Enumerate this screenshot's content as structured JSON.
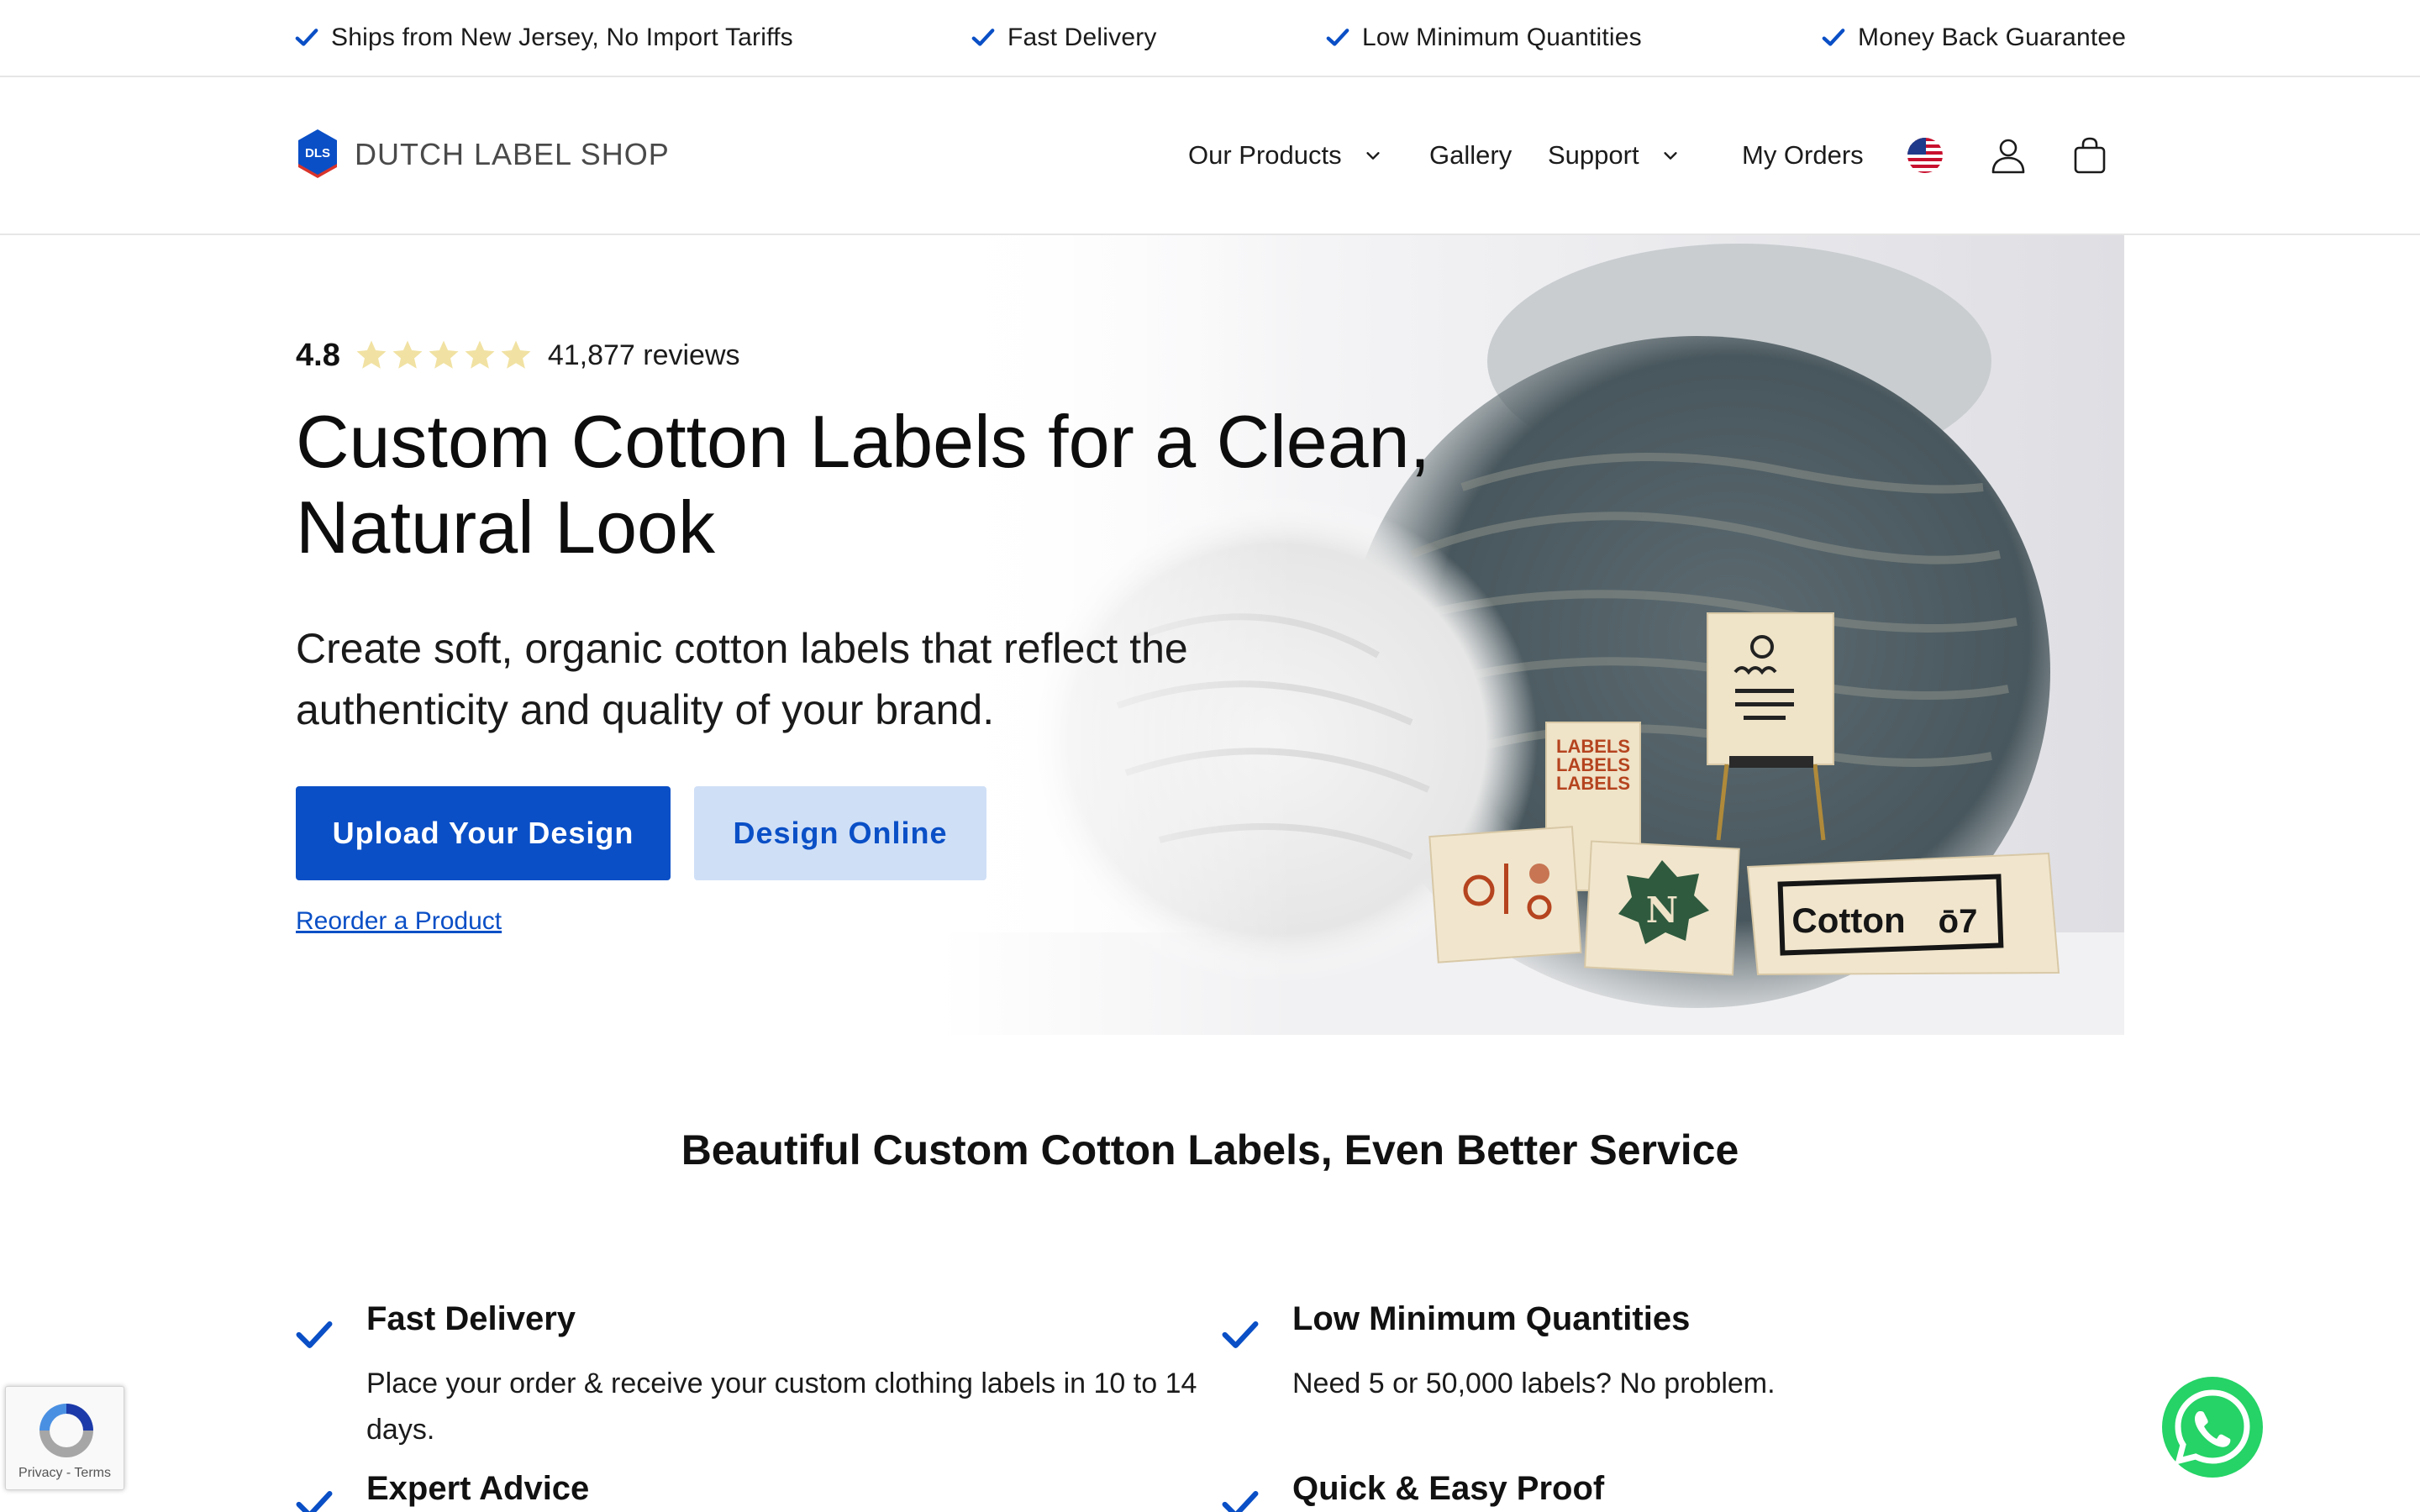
{
  "topbar": {
    "items": [
      "Ships from New Jersey, No Import Tariffs",
      "Fast Delivery",
      "Low Minimum Quantities",
      "Money Back Guarantee"
    ]
  },
  "header": {
    "logo_mark": "DLS",
    "logo_text": "DUTCH LABEL SHOP",
    "nav": {
      "products": "Our Products",
      "gallery": "Gallery",
      "support": "Support",
      "orders": "My Orders"
    },
    "icons": [
      "us-flag-icon",
      "user-icon",
      "shopping-bag-icon"
    ]
  },
  "hero": {
    "rating_score": "4.8",
    "stars": 5,
    "rating_count": "41,877 reviews",
    "title": "Custom Cotton Labels for a Clean, Natural Look",
    "subtitle": "Create soft, organic cotton labels that reflect the authenticity and quality of your brand.",
    "primary_button": "Upload Your Design",
    "secondary_button": "Design Online",
    "reorder_link": "Reorder a Product",
    "art_labels": {
      "labels_word": "LABELS",
      "cotton": "Cotton",
      "cotton_num": "ō7",
      "n_letter": "N"
    }
  },
  "section": {
    "title": "Beautiful Custom Cotton Labels, Even Better Service",
    "features": [
      {
        "title": "Fast Delivery",
        "text": "Place your order & receive your custom clothing labels in 10 to 14 days."
      },
      {
        "title": "Low Minimum Quantities",
        "text": "Need 5 or 50,000 labels? No problem."
      },
      {
        "title": "Expert Advice",
        "text": ""
      },
      {
        "title": "Quick & Easy Proof",
        "text": ""
      }
    ]
  },
  "recaptcha": {
    "links": "Privacy - Terms"
  },
  "colors": {
    "accent": "#0a4fc6",
    "accent_light": "#cfdff6",
    "star": "#f1e2a3",
    "whatsapp": "#25d366"
  }
}
